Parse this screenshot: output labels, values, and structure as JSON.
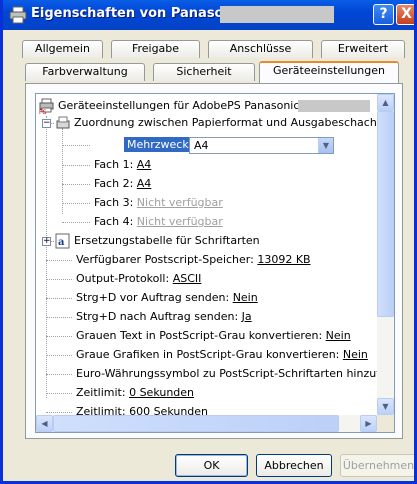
{
  "window": {
    "title": "Eigenschaften von Panasonic",
    "help_label": "?",
    "close_label": "X"
  },
  "tabs_row1": [
    "Allgemein",
    "Freigabe",
    "Anschlüsse",
    "Erweitert"
  ],
  "tabs_row2": [
    "Farbverwaltung",
    "Sicherheit",
    "Geräteeinstellungen"
  ],
  "tree": {
    "root": "Geräteeinstellungen für AdobePS Panasonic",
    "mapping_group": "Zuordnung zwischen Papierformat und Ausgabeschacht",
    "mehrzweckfach_label": "Mehrzweckfach:",
    "mehrzweckfach_value": "A4",
    "fach1_label": "Fach 1:",
    "fach1_value": "A4",
    "fach2_label": "Fach 2:",
    "fach2_value": "A4",
    "fach3_label": "Fach 3:",
    "fach3_value": "Nicht verfügbar",
    "fach4_label": "Fach 4:",
    "fach4_value": "Nicht verfügbar",
    "font_table": "Ersetzungstabelle für Schriftarten",
    "memory_label": "Verfügbarer Postscript-Speicher:",
    "memory_value": "13092 KB",
    "output_label": "Output-Protokoll:",
    "output_value": "ASCII",
    "ctrl_d_before_label": "Strg+D vor Auftrag senden:",
    "ctrl_d_before_value": "Nein",
    "ctrl_d_after_label": "Strg+D nach Auftrag senden:",
    "ctrl_d_after_value": "Ja",
    "gray_text_label": "Grauen Text in PostScript-Grau konvertieren:",
    "gray_text_value": "Nein",
    "gray_graphics_label": "Graue Grafiken in PostScript-Grau konvertieren:",
    "gray_graphics_value": "Nein",
    "euro_label": "Euro-Währungssymbol zu PostScript-Schriftarten hinzufügen:",
    "timeout1_label": "Zeitlimit:",
    "timeout1_value": "0 Sekunden",
    "timeout2_label": "Zeitlimit:",
    "timeout2_value": "600 Sekunden"
  },
  "buttons": {
    "ok": "OK",
    "cancel": "Abbrechen",
    "apply": "Übernehmen"
  },
  "icons": {
    "title": "printer-icon",
    "help": "help-icon",
    "close": "close-icon",
    "root": "printer-settings-icon",
    "mapping": "paper-tray-icon",
    "font_table": "font-icon",
    "combo_arrow": "chevron-down-icon"
  },
  "colors": {
    "titlebar": "#0046d5",
    "selection": "#316ac5",
    "tab_highlight": "#e68b2c",
    "dialog_bg": "#ece9d8"
  }
}
